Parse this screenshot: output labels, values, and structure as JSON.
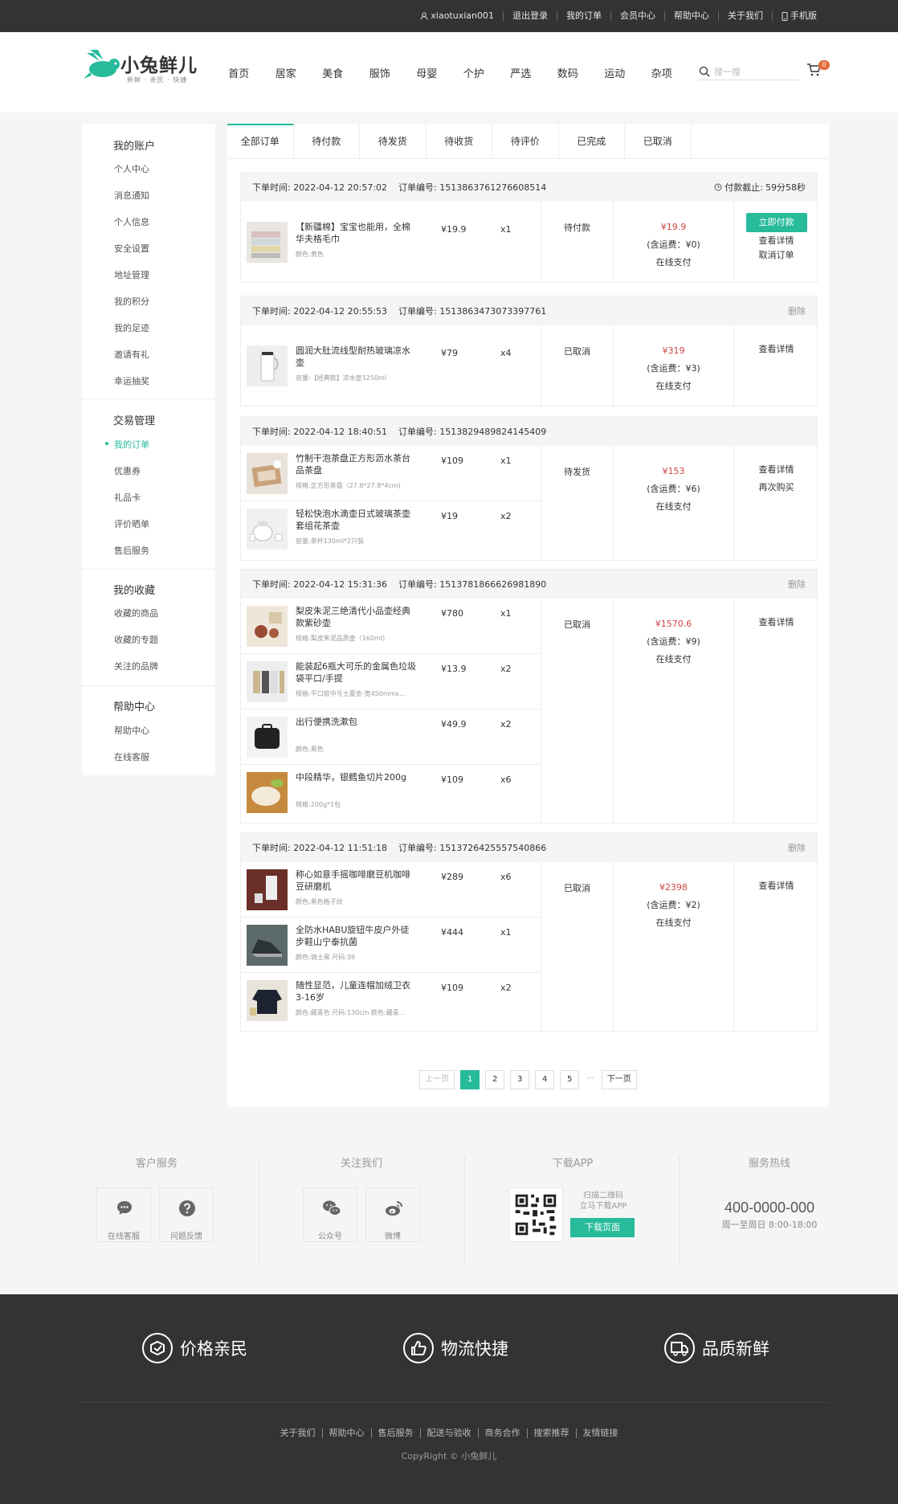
{
  "topbar": {
    "username": "xiaotuxian001",
    "links": [
      "退出登录",
      "我的订单",
      "会员中心",
      "帮助中心",
      "关于我们",
      "手机版"
    ]
  },
  "brand": {
    "name": "小兔鲜儿",
    "slogan": "新鲜 · 亲民 · 快捷",
    "accent": "#27ba9b"
  },
  "nav": [
    "首页",
    "居家",
    "美食",
    "服饰",
    "母婴",
    "个护",
    "严选",
    "数码",
    "运动",
    "杂项"
  ],
  "search": {
    "placeholder": "搜一搜"
  },
  "cart": {
    "count": "0"
  },
  "sidebar": {
    "groups": [
      {
        "title": "我的账户",
        "items": [
          "个人中心",
          "消息通知",
          "个人信息",
          "安全设置",
          "地址管理",
          "我的积分",
          "我的足迹",
          "邀请有礼",
          "幸运抽奖"
        ]
      },
      {
        "title": "交易管理",
        "items": [
          "我的订单",
          "优惠券",
          "礼品卡",
          "评价晒单",
          "售后服务"
        ]
      },
      {
        "title": "我的收藏",
        "items": [
          "收藏的商品",
          "收藏的专题",
          "关注的品牌"
        ]
      },
      {
        "title": "帮助中心",
        "items": [
          "帮助中心",
          "在线客服"
        ]
      }
    ]
  },
  "tabs": [
    "全部订单",
    "待付款",
    "待发货",
    "待收货",
    "待评价",
    "已完成",
    "已取消"
  ],
  "labels": {
    "time": "下单时间:",
    "no": "订单编号:",
    "deadline": "付款截止:",
    "delete": "删除",
    "pay_now": "立即付款",
    "view": "查看详情",
    "cancel": "取消订单",
    "rebuy": "再次购买",
    "online": "在线支付"
  },
  "orders": [
    {
      "time": "2022-04-12 20:57:02",
      "no": "1513863761276608514",
      "countdown": "59分58秒",
      "status": "待付款",
      "amount": "¥19.9",
      "freight": "(含运费：¥0)",
      "goods": [
        {
          "name": "【新疆棉】宝宝也能用，全棉华夫格毛巾",
          "spec": "颜色:黄色",
          "price": "¥19.9",
          "qty": "x1"
        }
      ]
    },
    {
      "time": "2022-04-12 20:55:53",
      "no": "1513863473073397761",
      "status": "已取消",
      "amount": "¥319",
      "freight": "(含运费：¥3)",
      "goods": [
        {
          "name": "圆润大肚流线型耐热玻璃凉水壶",
          "spec": "容量:【经典款】凉水壶1250ml",
          "price": "¥79",
          "qty": "x4"
        }
      ]
    },
    {
      "time": "2022-04-12 18:40:51",
      "no": "1513829489824145409",
      "status": "待发货",
      "amount": "¥153",
      "freight": "(含运费：¥6)",
      "goods": [
        {
          "name": "竹制干泡茶盘正方形沥水茶台品茶盘",
          "spec": "规格:正方形茶盘（27.8*27.8*4cm)",
          "price": "¥109",
          "qty": "x1"
        },
        {
          "name": "轻松快泡水滴壶日式玻璃茶壶套组花茶壶",
          "spec": "容量:茶杯130ml*2只装",
          "price": "¥19",
          "qty": "x2"
        }
      ]
    },
    {
      "time": "2022-04-12 15:31:36",
      "no": "1513781866626981890",
      "status": "已取消",
      "amount": "¥1570.6",
      "freight": "(含运费：¥9)",
      "goods": [
        {
          "name": "梨皮朱泥三绝清代小品壶经典款紫砂壶",
          "spec": "规格:梨皮朱泥品质壶（160ml)",
          "price": "¥780",
          "qty": "x1"
        },
        {
          "name": "能装起6瓶大可乐的金属色垃圾袋平口/手提",
          "spec": "规格:平口款中号土豪金-宽450mmx...",
          "price": "¥13.9",
          "qty": "x2"
        },
        {
          "name": "出行便携洗漱包",
          "spec": "颜色:黑色",
          "price": "¥49.9",
          "qty": "x2"
        },
        {
          "name": "中段精华，银鳕鱼切片200g",
          "spec": "规格:200g*1包",
          "price": "¥109",
          "qty": "x6"
        }
      ]
    },
    {
      "time": "2022-04-12 11:51:18",
      "no": "1513726425557540866",
      "status": "已取消",
      "amount": "¥2398",
      "freight": "(含运费：¥2)",
      "goods": [
        {
          "name": "称心如意手摇咖啡磨豆机咖啡豆研磨机",
          "spec": "颜色:黑色格子纹",
          "price": "¥289",
          "qty": "x6"
        },
        {
          "name": "全防水HABU旋钮牛皮户外徒步鞋山宁泰抗菌",
          "spec": "颜色:骑士黑 尺码:39",
          "price": "¥444",
          "qty": "x1"
        },
        {
          "name": "随性显范，儿童连帽加绒卫衣3-16岁",
          "spec": "颜色:藏青色 尺码:130cm 颜色:藏青...",
          "price": "¥109",
          "qty": "x2"
        }
      ]
    }
  ],
  "pager": {
    "prev": "上一页",
    "pages": [
      "1",
      "2",
      "3",
      "4",
      "5"
    ],
    "dots": "...",
    "next": "下一页"
  },
  "service": {
    "cols": [
      {
        "title": "客户服务",
        "items": [
          "在线客服",
          "问题反馈"
        ]
      },
      {
        "title": "关注我们",
        "items": [
          "公众号",
          "微博"
        ]
      },
      {
        "title": "下载APP",
        "qr_text_1": "扫描二维码",
        "qr_text_2": "立马下载APP",
        "button": "下载页面"
      },
      {
        "title": "服务热线",
        "phone": "400-0000-000",
        "hours": "周一至周日 8:00-18:00"
      }
    ]
  },
  "promos": [
    "价格亲民",
    "物流快捷",
    "品质新鲜"
  ],
  "footer_links": [
    "关于我们",
    "帮助中心",
    "售后服务",
    "配送与验收",
    "商务合作",
    "搜索推荐",
    "友情链接"
  ],
  "copyright": "CopyRight © 小兔鲜儿"
}
